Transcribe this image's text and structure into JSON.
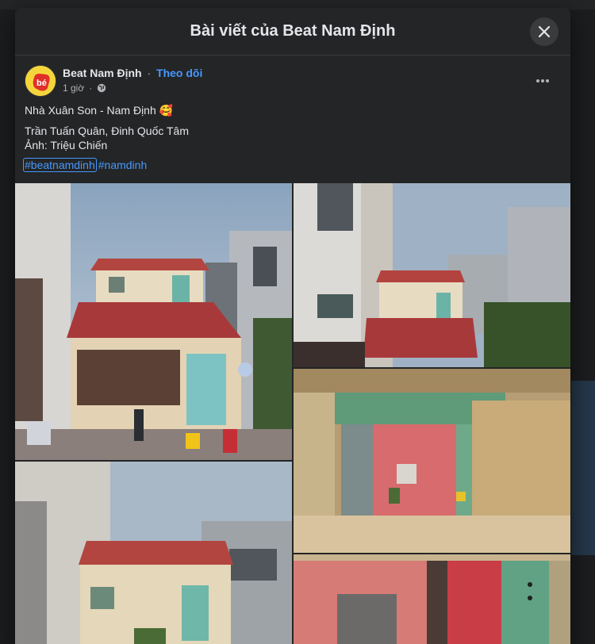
{
  "modal": {
    "title": "Bài viết của Beat Nam Định"
  },
  "post": {
    "author": "Beat Nam Định",
    "separator": "·",
    "follow_label": "Theo dõi",
    "time": "1 giờ",
    "privacy_icon": "globe-icon",
    "text_lines": [
      "Nhà Xuân Son - Nam Định 🥰",
      "Trần Tuấn Quân, Đinh Quốc Tâm",
      "Ảnh: Triệu Chiến"
    ],
    "hashtags": [
      "#beatnamdinh",
      "#namdinh"
    ]
  },
  "photos": [
    {
      "name": "house-facade-front",
      "icon": "photo"
    },
    {
      "name": "house-facade-angle",
      "icon": "photo"
    },
    {
      "name": "interior-courtyard",
      "icon": "photo"
    },
    {
      "name": "house-facade-closeup",
      "icon": "photo"
    },
    {
      "name": "interior-pink-wall",
      "icon": "photo"
    }
  ],
  "colors": {
    "modal_bg": "#242526",
    "accent": "#4599ff",
    "text_primary": "#e4e6eb",
    "text_secondary": "#b0b3b8"
  }
}
